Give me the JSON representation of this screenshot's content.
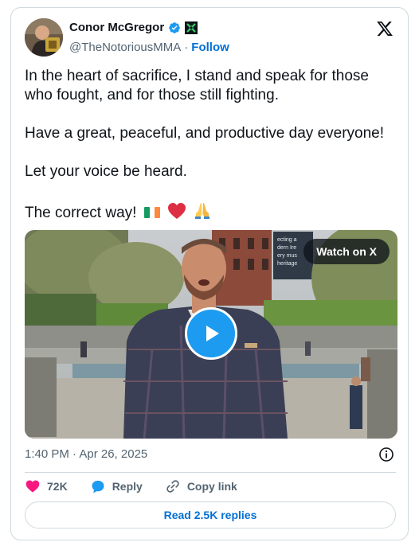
{
  "author": {
    "name": "Conor McGregor",
    "handle": "@TheNotoriousMMA",
    "separator": "·",
    "follow_label": "Follow"
  },
  "tweet": {
    "paragraphs": [
      "In the heart of sacrifice, I stand and speak for those who fought, and for those still fighting.",
      "Have a great, peaceful, and productive day everyone!",
      "Let your voice be heard.",
      "The correct way!"
    ],
    "emojis": [
      "irish-flag",
      "red-heart",
      "folded-hands"
    ]
  },
  "media": {
    "watch_label": "Watch on X",
    "sign_lines": [
      "ecting a",
      "dern Ire",
      "ery mus",
      "heritage"
    ]
  },
  "meta": {
    "timestamp": "1:40 PM · Apr 26, 2025"
  },
  "actions": {
    "likes": "72K",
    "reply_label": "Reply",
    "copy_label": "Copy link",
    "read_replies": "Read 2.5K replies"
  },
  "colors": {
    "link": "#006fd6",
    "like": "#f91880",
    "play": "#1d9bf0",
    "border": "#cfd9de"
  }
}
